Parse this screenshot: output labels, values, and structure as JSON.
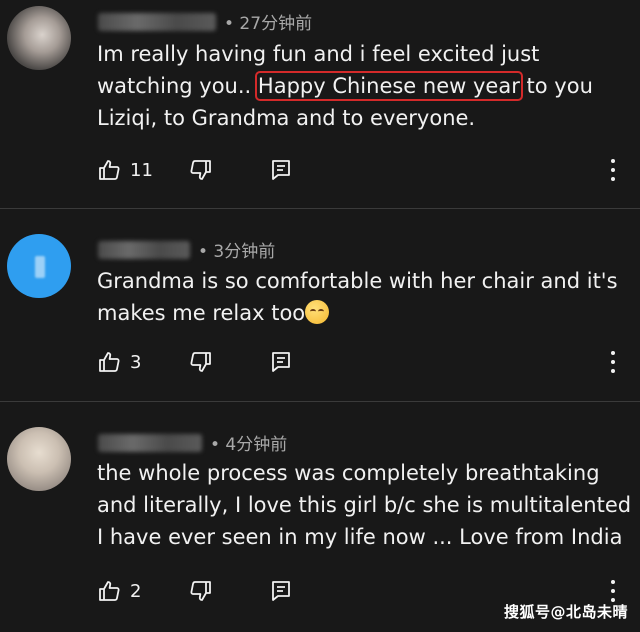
{
  "comments": [
    {
      "time": "• 27分钟前",
      "text_before": "Im really having fun and i feel excited just  watching you..",
      "text_highlight": "Happy Chinese new year",
      "text_after": "to you Liziqi, to Grandma and to everyone.",
      "likes": "11"
    },
    {
      "time": "• 3分钟前",
      "text": "Grandma is so comfortable with her chair and it's makes me relax too",
      "emoji": "relieved-face",
      "likes": "3"
    },
    {
      "time": "• 4分钟前",
      "text": "the whole process was completely breathtaking and literally, I love this girl b/c she is multitalented I have ever seen in my life now ... Love from India",
      "likes": "2"
    }
  ],
  "watermark": "搜狐号@北岛未晴",
  "colors": {
    "background": "#181818",
    "text": "#f1f1f1",
    "meta": "#a8a8a8",
    "highlight_box": "#d42a2a",
    "avatar_blue": "#2f9ef0"
  }
}
